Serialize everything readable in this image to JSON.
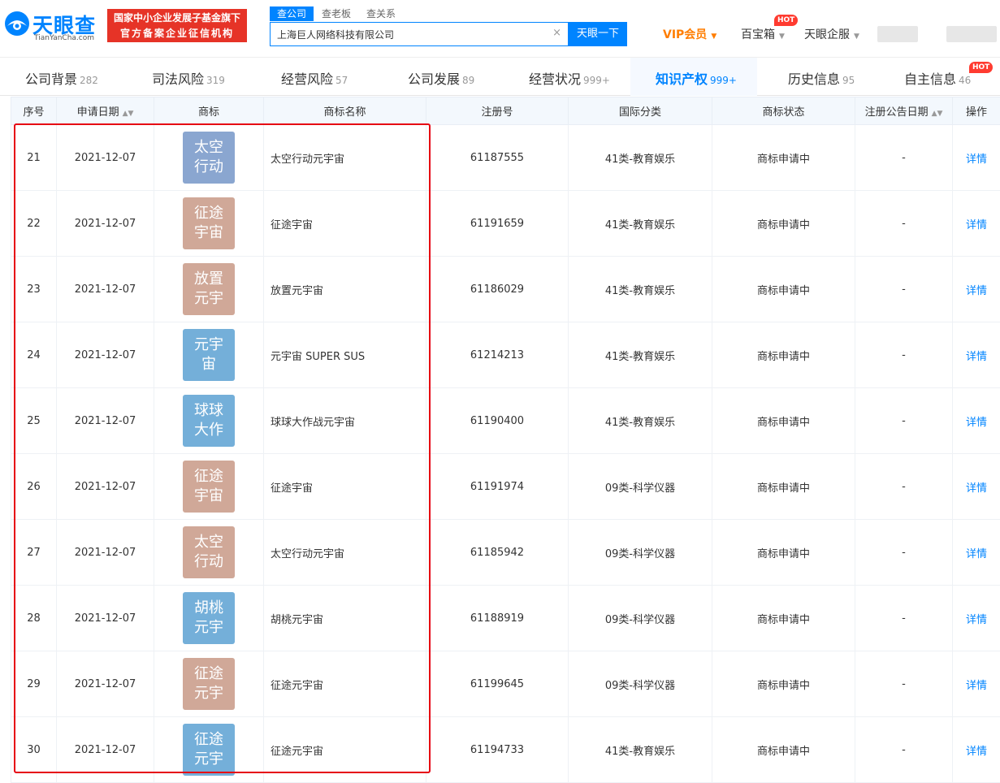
{
  "brand": {
    "logo_text": "天眼查",
    "logo_domain": "TianYanCha.com",
    "fund_line1": "国家中小企业发展子基金旗下",
    "fund_line2": "官方备案企业征信机构"
  },
  "search": {
    "tabs": [
      "查公司",
      "查老板",
      "查关系"
    ],
    "query": "上海巨人网络科技有限公司",
    "clear_icon": "×",
    "button": "天眼一下"
  },
  "nav": {
    "vip": "VIP会员",
    "treasure": "百宝箱",
    "treasure_badge": "HOT",
    "enterprise": "天眼企服"
  },
  "category_tabs": [
    {
      "label": "公司背景",
      "count": "282"
    },
    {
      "label": "司法风险",
      "count": "319"
    },
    {
      "label": "经营风险",
      "count": "57"
    },
    {
      "label": "公司发展",
      "count": "89"
    },
    {
      "label": "经营状况",
      "count": "999+"
    },
    {
      "label": "知识产权",
      "count": "999+"
    },
    {
      "label": "历史信息",
      "count": "95"
    },
    {
      "label": "自主信息",
      "count": "46",
      "badge": "HOT"
    }
  ],
  "active_tab": "知识产权",
  "colors": {
    "accent": "#0084ff",
    "fund_red": "#e63327",
    "vip_orange": "#ff7d00",
    "hot_red": "#ff3b30",
    "highlight_red": "#e60012",
    "tm_blue": "#8aa6d0",
    "tm_sky": "#74afd9",
    "tm_tan": "#d0a898"
  },
  "table": {
    "headers": {
      "index": "序号",
      "date": "申请日期",
      "trademark": "商标",
      "name": "商标名称",
      "reg_no": "注册号",
      "class": "国际分类",
      "status": "商标状态",
      "pub_date": "注册公告日期",
      "action": "操作"
    },
    "rows": [
      {
        "index": "21",
        "date": "2021-12-07",
        "tm_line1": "太空",
        "tm_line2": "行动",
        "tm_color": "#8aa6d0",
        "name": "太空行动元宇宙",
        "reg_no": "61187555",
        "class": "41类-教育娱乐",
        "status": "商标申请中",
        "pub_date": "-",
        "action": "详情"
      },
      {
        "index": "22",
        "date": "2021-12-07",
        "tm_line1": "征途",
        "tm_line2": "宇宙",
        "tm_color": "#d0a898",
        "name": "征途宇宙",
        "reg_no": "61191659",
        "class": "41类-教育娱乐",
        "status": "商标申请中",
        "pub_date": "-",
        "action": "详情"
      },
      {
        "index": "23",
        "date": "2021-12-07",
        "tm_line1": "放置",
        "tm_line2": "元宇",
        "tm_color": "#d0a898",
        "name": "放置元宇宙",
        "reg_no": "61186029",
        "class": "41类-教育娱乐",
        "status": "商标申请中",
        "pub_date": "-",
        "action": "详情"
      },
      {
        "index": "24",
        "date": "2021-12-07",
        "tm_line1": "元宇",
        "tm_line2": "宙",
        "tm_color": "#74afd9",
        "name": "元宇宙 SUPER SUS",
        "reg_no": "61214213",
        "class": "41类-教育娱乐",
        "status": "商标申请中",
        "pub_date": "-",
        "action": "详情"
      },
      {
        "index": "25",
        "date": "2021-12-07",
        "tm_line1": "球球",
        "tm_line2": "大作",
        "tm_color": "#74afd9",
        "name": "球球大作战元宇宙",
        "reg_no": "61190400",
        "class": "41类-教育娱乐",
        "status": "商标申请中",
        "pub_date": "-",
        "action": "详情"
      },
      {
        "index": "26",
        "date": "2021-12-07",
        "tm_line1": "征途",
        "tm_line2": "宇宙",
        "tm_color": "#d0a898",
        "name": "征途宇宙",
        "reg_no": "61191974",
        "class": "09类-科学仪器",
        "status": "商标申请中",
        "pub_date": "-",
        "action": "详情"
      },
      {
        "index": "27",
        "date": "2021-12-07",
        "tm_line1": "太空",
        "tm_line2": "行动",
        "tm_color": "#d0a898",
        "name": "太空行动元宇宙",
        "reg_no": "61185942",
        "class": "09类-科学仪器",
        "status": "商标申请中",
        "pub_date": "-",
        "action": "详情"
      },
      {
        "index": "28",
        "date": "2021-12-07",
        "tm_line1": "胡桃",
        "tm_line2": "元宇",
        "tm_color": "#74afd9",
        "name": "胡桃元宇宙",
        "reg_no": "61188919",
        "class": "09类-科学仪器",
        "status": "商标申请中",
        "pub_date": "-",
        "action": "详情"
      },
      {
        "index": "29",
        "date": "2021-12-07",
        "tm_line1": "征途",
        "tm_line2": "元宇",
        "tm_color": "#d0a898",
        "name": "征途元宇宙",
        "reg_no": "61199645",
        "class": "09类-科学仪器",
        "status": "商标申请中",
        "pub_date": "-",
        "action": "详情"
      },
      {
        "index": "30",
        "date": "2021-12-07",
        "tm_line1": "征途",
        "tm_line2": "元宇",
        "tm_color": "#74afd9",
        "name": "征途元宇宙",
        "reg_no": "61194733",
        "class": "41类-教育娱乐",
        "status": "商标申请中",
        "pub_date": "-",
        "action": "详情"
      }
    ]
  }
}
